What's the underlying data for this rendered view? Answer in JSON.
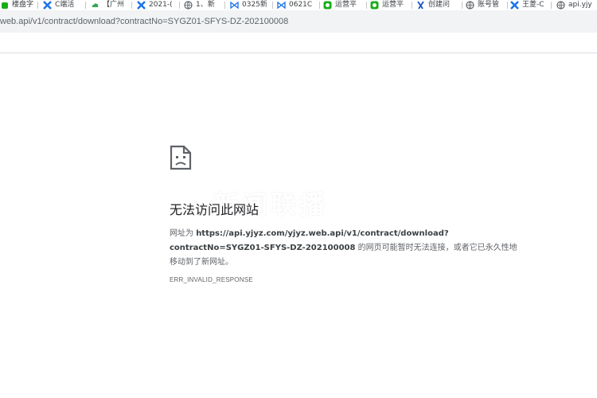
{
  "bookmarks": [
    {
      "label": "楼盘字",
      "icon": "square-green-icon"
    },
    {
      "label": "C端活",
      "icon": "blue-x-icon"
    },
    {
      "label": "【广州",
      "icon": "green-cloud-icon"
    },
    {
      "label": "2021-(",
      "icon": "blue-x-icon"
    },
    {
      "label": "1、新",
      "icon": "globe-icon"
    },
    {
      "label": "0325新",
      "icon": "bowtie-icon"
    },
    {
      "label": "0621C",
      "icon": "bowtie-icon"
    },
    {
      "label": "运营平",
      "icon": "green-bubble-icon"
    },
    {
      "label": "运营平",
      "icon": "green-bubble-icon"
    },
    {
      "label": "创建问",
      "icon": "blue-figure-icon"
    },
    {
      "label": "账号管",
      "icon": "globe-icon"
    },
    {
      "label": "王菱-C",
      "icon": "blue-x-icon"
    },
    {
      "label": "api.yjy",
      "icon": "globe-icon"
    }
  ],
  "address_bar": {
    "url": "web.api/v1/contract/download?contractNo=SYGZ01-SFYS-DZ-202100008"
  },
  "watermark": "新闻联播",
  "error": {
    "title": "无法访问此网站",
    "prefix": "网址为 ",
    "url_line1": "https://api.yjyz.com/yjyz.web.api/v1/contract/download?",
    "url_line2": "contractNo=SYGZ01-SFYS-DZ-202100008",
    "suffix": " 的网页可能暂时无法连接，或者它已永久性地",
    "line3": "移动到了新网址。",
    "code": "ERR_INVALID_RESPONSE"
  }
}
